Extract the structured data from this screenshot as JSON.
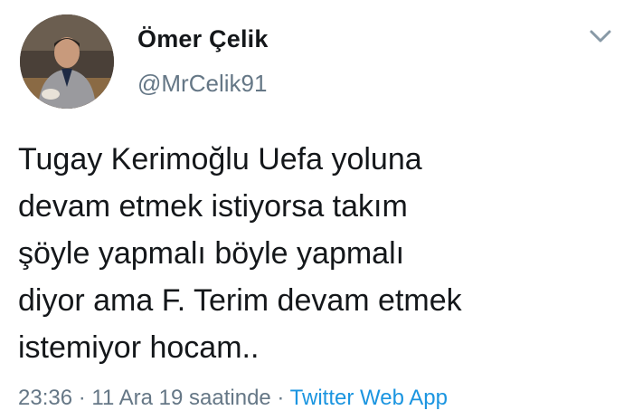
{
  "author": {
    "display_name": "Ömer Çelik",
    "handle": "@MrCelik91"
  },
  "menu_icon": "chevron-down-icon",
  "tweet": {
    "lines": [
      "Tugay Kerimoğlu Uefa yoluna",
      "devam etmek istiyorsa takım",
      "şöyle yapmalı böyle yapmalı",
      "diyor ama F. Terim devam etmek",
      "istemiyor hocam.."
    ]
  },
  "meta": {
    "time": "23:36",
    "separator1": " · ",
    "date": "11 Ara 19 saatinde",
    "separator2": " · ",
    "source": "Twitter Web App"
  },
  "colors": {
    "text": "#14171a",
    "secondary": "#657786",
    "link": "#1b95e0"
  }
}
